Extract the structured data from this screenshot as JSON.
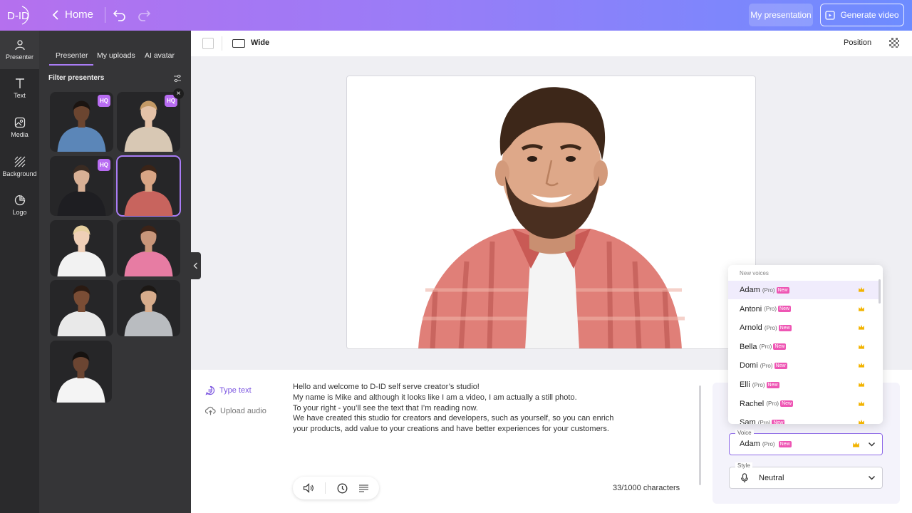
{
  "topbar": {
    "logo": "D-ID",
    "back_label": "Home",
    "my_presentation": "My presentation",
    "generate_video": "Generate video"
  },
  "rail": {
    "items": [
      {
        "label": "Presenter",
        "icon": "person-icon"
      },
      {
        "label": "Text",
        "icon": "text-icon"
      },
      {
        "label": "Media",
        "icon": "media-icon"
      },
      {
        "label": "Background",
        "icon": "background-icon"
      },
      {
        "label": "Logo",
        "icon": "logo-icon"
      }
    ]
  },
  "panel": {
    "tabs": [
      "Presenter",
      "My uploads",
      "AI avatar"
    ],
    "filter_label": "Filter presenters",
    "hq_label": "HQ",
    "close_label": "×",
    "presenters": [
      {
        "hq": true,
        "shirt": "#5b86b8",
        "skin": "#6b4530",
        "hair": "#1b1411"
      },
      {
        "hq": true,
        "shirt": "#d8c8b4",
        "skin": "#e4c2a8",
        "hair": "#c49a66"
      },
      {
        "hq": true,
        "shirt": "#1e1e22",
        "skin": "#d8b095",
        "hair": "#3a2b22"
      },
      {
        "hq": false,
        "shirt": "#c8645e",
        "skin": "#d9a585",
        "hair": "#3a2418",
        "selected": true
      },
      {
        "hq": false,
        "shirt": "#f2f2f2",
        "skin": "#efcfb7",
        "hair": "#e6cf9f"
      },
      {
        "hq": false,
        "shirt": "#e77ca3",
        "skin": "#c9967a",
        "hair": "#3b2318"
      },
      {
        "hq": false,
        "shirt": "#e9e9e9",
        "skin": "#7a4d35",
        "hair": "#2a1a12"
      },
      {
        "hq": false,
        "shirt": "#b9bcc0",
        "skin": "#d7ac8c",
        "hair": "#1c1815"
      },
      {
        "hq": false,
        "shirt": "#f4f4f4",
        "skin": "#6b4532",
        "hair": "#161210"
      }
    ]
  },
  "canvas": {
    "ratio_label": "Wide",
    "position_label": "Position"
  },
  "editor": {
    "type_text": "Type text",
    "upload_audio": "Upload audio",
    "script_lines": [
      "Hello and welcome to D-ID self serve creator’s studio!",
      "My name is Mike and although it looks like I am a video, I am actually a still photo.",
      "To your right - you’ll see the text that I’m reading now.",
      "We have created this studio for creators and developers, such as yourself, so you can enrich",
      "your products, add value to your creations and have better experiences for your customers."
    ],
    "char_count": "33/1000 characters"
  },
  "voice_dropdown": {
    "header": "New voices",
    "pro_label": "(Pro)",
    "new_label": "New",
    "items": [
      "Adam",
      "Antoni",
      "Arnold",
      "Bella",
      "Domi",
      "Elli",
      "Rachel",
      "Sam"
    ]
  },
  "voice_field": {
    "label": "Voice",
    "value": "Adam",
    "pro_label": "(Pro)",
    "new_label": "New"
  },
  "style_field": {
    "label": "Style",
    "value": "Neutral"
  },
  "colors": {
    "accent": "#8f6be8",
    "new_badge": "#ee56b4",
    "hq_badge": "#b86cf2",
    "crown": "#f2b300"
  }
}
